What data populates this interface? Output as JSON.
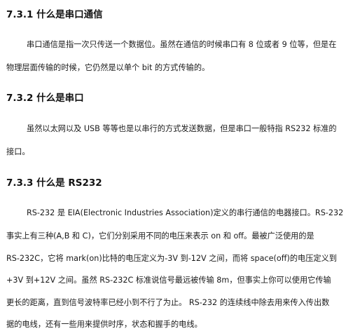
{
  "sections": [
    {
      "heading": "7.3.1 什么是串口通信",
      "lines": [
        "串口通信是指一次只传送一个数据位。虽然在通信的时候串口有 8 位或者 9 位等，但是在",
        "物理层面传输的时候，它仍然是以单个 bit 的方式传输的。"
      ]
    },
    {
      "heading": "7.3.2 什么是串口",
      "lines": [
        "虽然以太网以及 USB 等等也是以串行的方式发送数据，但是串口一般特指 RS232 标准的",
        "接口。"
      ]
    },
    {
      "heading": "7.3.3 什么是 RS232",
      "lines": [
        "RS-232 是 EIA(Electronic Industries Association)定义的串行通信的电器接口。RS-232",
        "事实上有三种(A,B 和 C)，它们分别采用不同的电压来表示 on 和 off。最被广泛使用的是",
        "RS-232C，它将 mark(on)比特的电压定义为-3V 到-12V 之间，而将 space(off)的电压定义到",
        "+3V 到+12V 之间。虽然 RS-232C 标准说信号最远被传输 8m，但事实上你可以使用它传输",
        "更长的距离，直到信号波特率已经小到不行了为止。 RS-232 的连续线中除去用来传入传出数",
        "据的电线，还有一些用来提供时序，状态和握手的电线。"
      ]
    }
  ]
}
